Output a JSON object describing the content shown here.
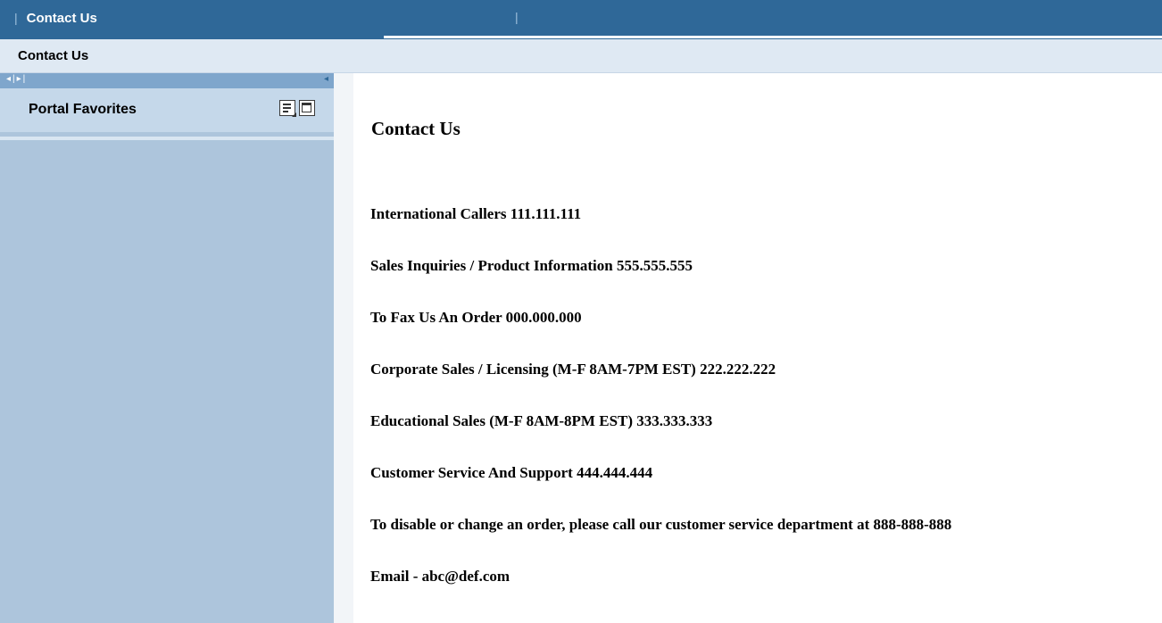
{
  "topnav": {
    "tab_label": "Contact Us"
  },
  "page_header": {
    "title": "Contact Us"
  },
  "left_panel": {
    "favorites_label": "Portal Favorites",
    "menu_icon": "list-menu-icon",
    "window_icon": "window-icon"
  },
  "content": {
    "heading": "Contact Us",
    "lines": [
      "International Callers 111.111.111",
      "Sales Inquiries / Product Information 555.555.555",
      "To Fax Us An Order 000.000.000",
      "Corporate Sales / Licensing (M-F 8AM-7PM EST) 222.222.222",
      "Educational Sales (M-F 8AM-8PM EST) 333.333.333",
      "Customer Service And Support 444.444.444",
      "To disable or change an order, please call our customer service department at 888-888-888",
      "Email - abc@def.com"
    ]
  },
  "colors": {
    "topbar": "#2f6898",
    "header": "#dfe9f3",
    "panel": "#adc5dc",
    "panel_header": "#c5d8ea"
  }
}
